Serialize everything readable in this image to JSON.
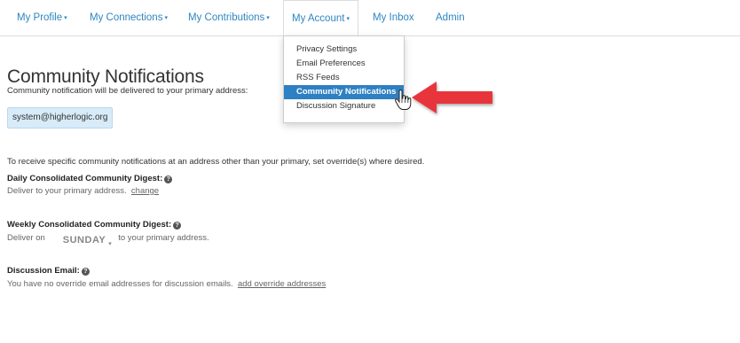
{
  "nav": {
    "items": [
      {
        "label": "My Profile",
        "has_caret": true
      },
      {
        "label": "My Connections",
        "has_caret": true
      },
      {
        "label": "My Contributions",
        "has_caret": true
      },
      {
        "label": "My Account",
        "has_caret": true
      },
      {
        "label": "My Inbox",
        "has_caret": false
      },
      {
        "label": "Admin",
        "has_caret": false
      }
    ],
    "caret": "▾",
    "active": "My Account"
  },
  "dropdown": {
    "items": [
      {
        "label": "Privacy Settings"
      },
      {
        "label": "Email Preferences"
      },
      {
        "label": "RSS Feeds"
      },
      {
        "label": "Community Notifications"
      },
      {
        "label": "Discussion Signature"
      }
    ],
    "selected": "Community Notifications"
  },
  "main": {
    "title": "Community Notifications",
    "subtitle": "Community notification will be delivered to your primary address:",
    "primary_email": "system@higherlogic.org",
    "override_info": "To receive specific community notifications at an address other than your primary, set override(s) where desired.",
    "daily": {
      "label": "Daily Consolidated Community Digest:",
      "desc": "Deliver to your primary address.",
      "link": "change"
    },
    "weekly": {
      "label": "Weekly Consolidated Community Digest:",
      "prefix": "Deliver on",
      "day": "SUNDAY",
      "suffix": "to your primary address."
    },
    "discussion": {
      "label": "Discussion Email:",
      "desc": "You have no override email addresses for discussion emails.",
      "link": "add override addresses"
    },
    "help_glyph": "?"
  },
  "colors": {
    "link_blue": "#2e86c1",
    "selected_bg": "#2f80c2",
    "chip_bg": "#d8ebf8",
    "arrow_red": "#e8343a"
  }
}
